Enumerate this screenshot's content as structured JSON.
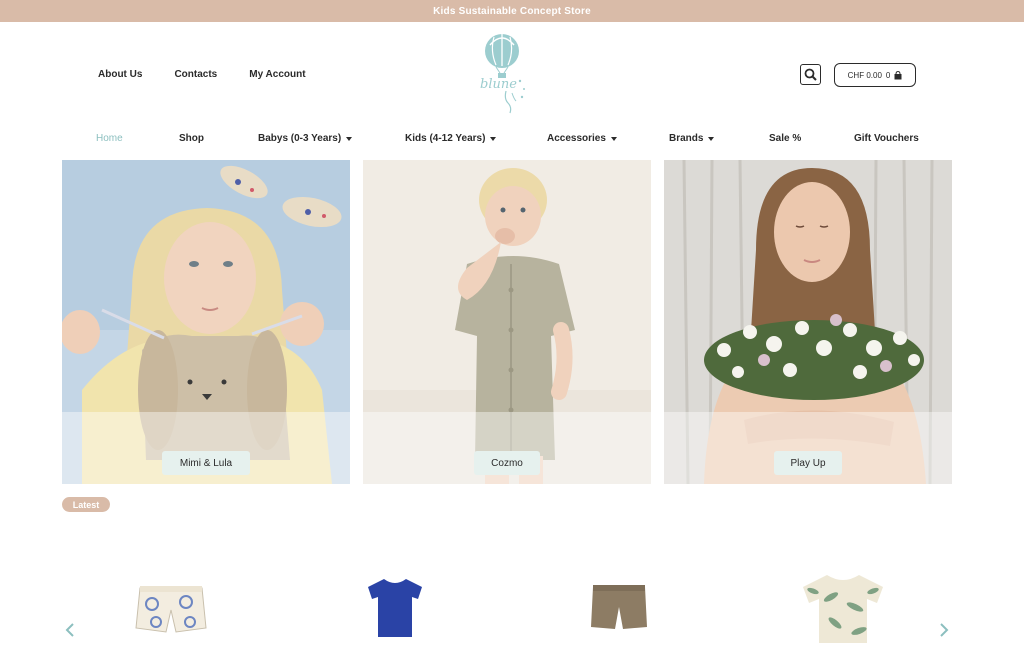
{
  "announcement": "Kids Sustainable Concept Store",
  "header_links": [
    "About Us",
    "Contacts",
    "My Account"
  ],
  "logo_text": "blune",
  "cart": {
    "label": "CHF 0.00",
    "count": "0"
  },
  "nav": {
    "home": "Home",
    "shop": "Shop",
    "babys": "Babys (0-3 Years)",
    "kids": "Kids (4-12 Years)",
    "accessories": "Accessories",
    "brands": "Brands",
    "sale": "Sale %",
    "vouchers": "Gift Vouchers"
  },
  "brand_tiles": [
    "Mimi & Lula",
    "Cozmo",
    "Play Up"
  ],
  "latest_badge": "Latest",
  "icons": {
    "search": "search-icon",
    "cart": "shopping-bag-icon",
    "prev": "chevron-left-icon",
    "next": "chevron-right-icon"
  },
  "colors": {
    "announcement_bg": "#d9bba8",
    "accent": "#8cbfbf",
    "brand_button_bg": "#e6f1ee"
  }
}
